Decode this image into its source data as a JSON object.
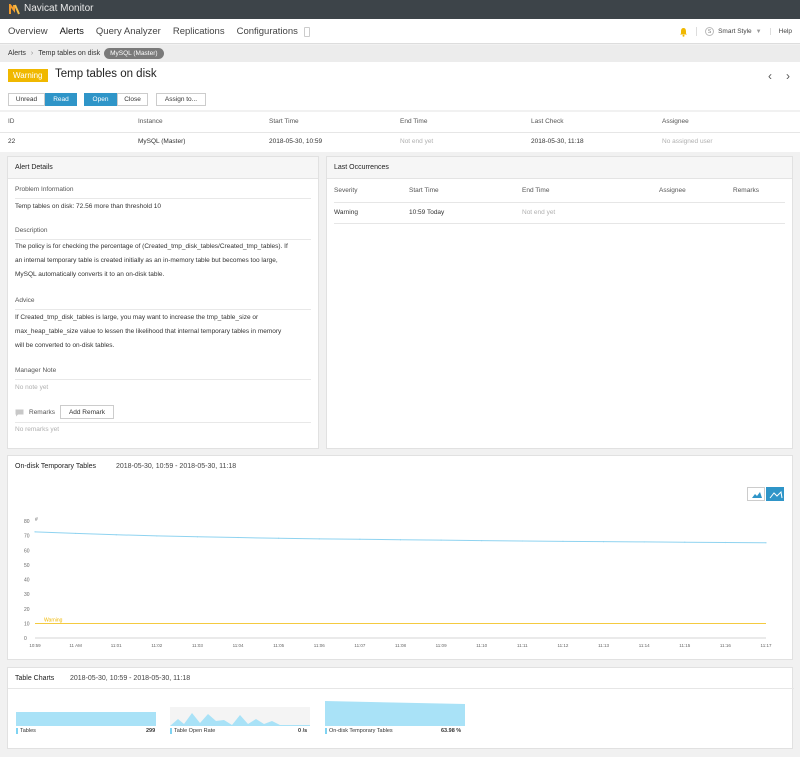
{
  "app": {
    "title": "Navicat Monitor"
  },
  "nav": {
    "items": [
      "Overview",
      "Alerts",
      "Query Analyzer",
      "Replications",
      "Configurations"
    ],
    "style_label": "Smart Style",
    "style_badge": "S",
    "help": "Help"
  },
  "breadcrumb": {
    "root": "Alerts",
    "current": "Temp tables on disk",
    "instance": "MySQL (Master)"
  },
  "alert": {
    "severity": "Warning",
    "title": "Temp tables on disk"
  },
  "actions": {
    "unread": "Unread",
    "read": "Read",
    "open": "Open",
    "close": "Close",
    "assign": "Assign to..."
  },
  "summary": {
    "headers": [
      "ID",
      "Instance",
      "Start Time",
      "End Time",
      "Last Check",
      "Assignee"
    ],
    "values": [
      "22",
      "MySQL (Master)",
      "2018-05-30, 10:59",
      "Not end yet",
      "2018-05-30, 11:18",
      "No assigned user"
    ]
  },
  "details": {
    "title": "Alert Details",
    "problem_label": "Problem Information",
    "problem_text": "Temp tables on disk: 72.56 more than threshold 10",
    "description_label": "Description",
    "description_lines": [
      "The policy is for checking the percentage of (Created_tmp_disk_tables/Created_tmp_tables). If",
      "an internal temporary table is created initially as an in-memory table but becomes too large,",
      "MySQL automatically converts it to an on-disk table."
    ],
    "advice_label": "Advice",
    "advice_lines": [
      "If Created_tmp_disk_tables is large, you may want to increase the tmp_table_size or",
      "max_heap_table_size value to lessen the likelihood that internal temporary tables in memory",
      "will be converted to on-disk tables."
    ],
    "manager_note_label": "Manager Note",
    "manager_note_text": "No note yet",
    "remarks_label": "Remarks",
    "add_remark": "Add Remark",
    "remarks_text": "No remarks yet"
  },
  "occurrences": {
    "title": "Last Occurrences",
    "headers": [
      "Severity",
      "Start Time",
      "End Time",
      "Assignee",
      "Remarks"
    ],
    "row": [
      "Warning",
      "10:59 Today",
      "Not end yet",
      "",
      ""
    ]
  },
  "chart_data": {
    "type": "line",
    "title": "On-disk Temporary Tables",
    "subtitle": "2018-05-30, 10:59 - 2018-05-30, 11:18",
    "ylabel": "#",
    "ylim": [
      0,
      80
    ],
    "yticks": [
      0,
      10,
      20,
      30,
      40,
      50,
      60,
      70,
      80
    ],
    "xticks": [
      "10:59",
      "11 AM",
      "11:01",
      "11:02",
      "11:03",
      "11:04",
      "11:05",
      "11:06",
      "11:07",
      "11:08",
      "11:09",
      "11:10",
      "11:11",
      "11:12",
      "11:13",
      "11:14",
      "11:15",
      "11:16",
      "11:17"
    ],
    "series": [
      {
        "values": [
          72.6,
          71.5,
          70.6,
          69.8,
          69.2,
          68.7,
          68.2,
          67.8,
          67.5,
          67.2,
          66.9,
          66.6,
          66.3,
          66.1,
          65.9,
          65.7,
          65.5,
          65.3,
          65.1
        ],
        "color": "#8fd3f0"
      }
    ],
    "threshold": {
      "label": "Warning",
      "value": 10,
      "color": "#f0b800"
    },
    "grid": false,
    "legend": "none"
  },
  "table_charts": {
    "title": "Table Charts",
    "range": "2018-05-30, 10:59 - 2018-05-30, 11:18",
    "items": [
      {
        "label": "Tables",
        "value": "299"
      },
      {
        "label": "Table Open Rate",
        "value": "0 /s"
      },
      {
        "label": "On-disk Temporary Tables",
        "value": "63.98 %"
      }
    ]
  },
  "colors": {
    "accent": "#2f95c8",
    "warning": "#f0b800",
    "topbar": "#3d4449",
    "series": "#8fd3f0"
  }
}
